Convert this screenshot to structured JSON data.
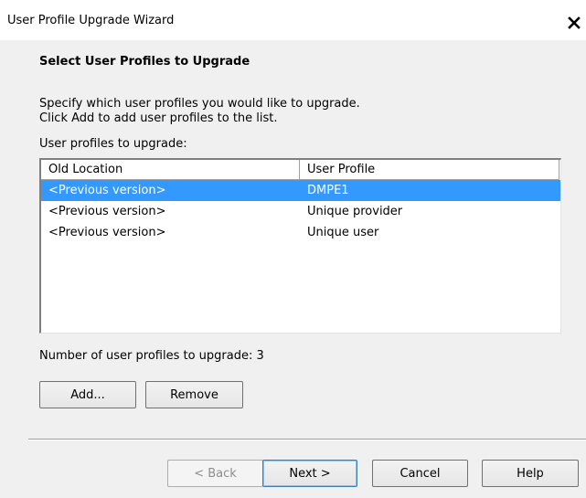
{
  "window": {
    "title": "User Profile Upgrade Wizard"
  },
  "page": {
    "heading": "Select User Profiles to Upgrade",
    "description_line1": "Specify which user profiles you would like to upgrade.",
    "description_line2": "Click Add to add user profiles to the list.",
    "list_label": "User profiles to upgrade:"
  },
  "list": {
    "columns": [
      "Old Location",
      "User Profile"
    ],
    "rows": [
      {
        "old_location": "<Previous version>",
        "user_profile": "DMPE1",
        "selected": true
      },
      {
        "old_location": "<Previous version>",
        "user_profile": "Unique provider",
        "selected": false
      },
      {
        "old_location": "<Previous version>",
        "user_profile": "Unique user",
        "selected": false
      }
    ]
  },
  "count": {
    "label": "Number of user profiles to upgrade:",
    "value": "3"
  },
  "buttons": {
    "add": "Add...",
    "remove": "Remove",
    "back": "< Back",
    "next": "Next >",
    "cancel": "Cancel",
    "help": "Help"
  },
  "colors": {
    "selection": "#3399ff",
    "dialog_bg": "#f0f0f0"
  },
  "icons": {
    "close": "close-icon"
  }
}
